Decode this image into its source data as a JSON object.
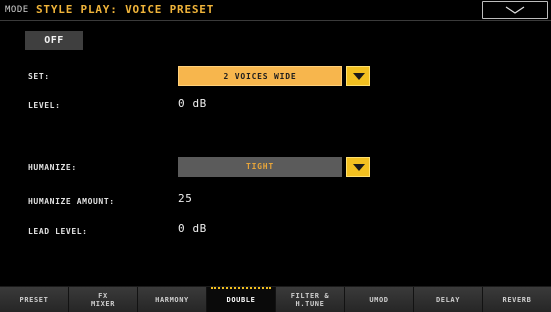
{
  "header": {
    "mode_label": "MODE",
    "title": "STYLE PLAY: VOICE PRESET",
    "menu_icon": "chevron-down-icon"
  },
  "main": {
    "off_label": "OFF",
    "set": {
      "label": "SET:",
      "value": "2 VOICES WIDE"
    },
    "level": {
      "label": "LEVEL:",
      "value": "0 dB"
    },
    "humanize": {
      "label": "HUMANIZE:",
      "value": "TIGHT"
    },
    "humanize_amount": {
      "label": "HUMANIZE AMOUNT:",
      "value": "25"
    },
    "lead_level": {
      "label": "LEAD LEVEL:",
      "value": "0 dB"
    }
  },
  "tabs": [
    {
      "line1": "PRESET",
      "line2": ""
    },
    {
      "line1": "FX",
      "line2": "MIXER"
    },
    {
      "line1": "HARMONY",
      "line2": ""
    },
    {
      "line1": "DOUBLE",
      "line2": ""
    },
    {
      "line1": "FILTER &",
      "line2": "H.TUNE"
    },
    {
      "line1": "UMOD",
      "line2": ""
    },
    {
      "line1": "DELAY",
      "line2": ""
    },
    {
      "line1": "REVERB",
      "line2": ""
    }
  ],
  "colors": {
    "accent": "#f0b43a",
    "selected_field": "#f7b64d",
    "dropdown_arrow_button": "#f2c020"
  }
}
